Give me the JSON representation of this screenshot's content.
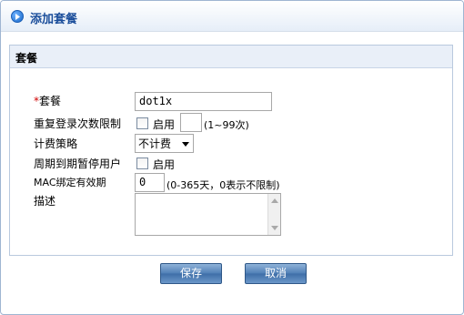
{
  "dialog": {
    "title": "添加套餐"
  },
  "panel": {
    "title": "套餐"
  },
  "form": {
    "package_label_req": "*",
    "package_label": "套餐",
    "package_value": "dot1x",
    "repeat_login_label": "重复登录次数限制",
    "repeat_login_enable_label": "启用",
    "repeat_login_value": "",
    "repeat_login_hint": "(1~99次)",
    "billing_label": "计费策略",
    "billing_value": "不计费",
    "periodic_suspend_label": "周期到期暂停用户",
    "periodic_suspend_enable_label": "启用",
    "mac_bind_label": "MAC绑定有效期",
    "mac_bind_value": "0",
    "mac_bind_hint": "(0-365天，0表示不限制)",
    "description_label": "描述",
    "description_value": ""
  },
  "buttons": {
    "save": "保存",
    "cancel": "取消"
  }
}
